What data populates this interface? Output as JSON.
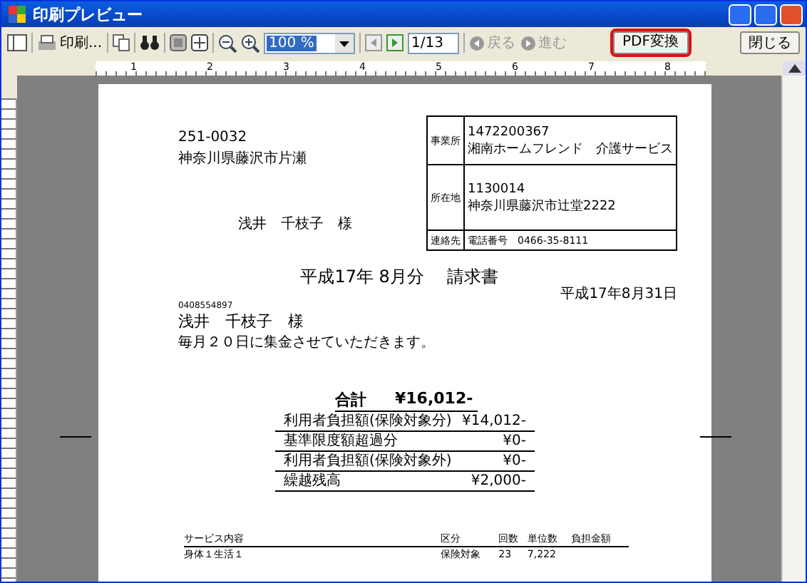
{
  "window": {
    "title": "印刷プレビュー"
  },
  "toolbar": {
    "print_label": "印刷...",
    "zoom": "100 %",
    "page": "1/13",
    "back": {
      "label": "戻る",
      "disabled": true
    },
    "forward": {
      "label": "進む",
      "disabled": true
    },
    "pdf_button": {
      "label": "PDF変換",
      "highlighted": true
    },
    "close_button": "閉じる"
  },
  "ruler": {
    "numbers": [
      "1",
      "2",
      "3",
      "4",
      "5",
      "6",
      "7",
      "8"
    ]
  },
  "document": {
    "sender": {
      "postcode": "251-0032",
      "address": "神奈川県藤沢市片瀬",
      "recipient": "浅井　千枝子　様"
    },
    "office_box": [
      {
        "label": "事業所",
        "lines": [
          "1472200367",
          "湘南ホームフレンド　介護サービス"
        ]
      },
      {
        "label": "所在地",
        "lines": [
          "1130014",
          "神奈川県藤沢市辻堂2222"
        ]
      },
      {
        "label": "連絡先",
        "lines": [
          "電話番号　0466-35-8111"
        ]
      }
    ],
    "title": "平成17年 8月分　 請求書",
    "date": "平成17年8月31日",
    "customer_code": "0408554897",
    "customer_name": "浅井　千枝子　様",
    "message": "毎月２０日に集金させていただきます。",
    "total": {
      "label": "合計",
      "amount": "¥16,012-"
    },
    "breakdown": [
      {
        "label": "利用者負担額(保険対象分)",
        "amount": "¥14,012-"
      },
      {
        "label": "基準限度額超過分",
        "amount": "¥0-"
      },
      {
        "label": "利用者負担額(保険対象外)",
        "amount": "¥0-"
      },
      {
        "label": "繰越残高",
        "amount": "¥2,000-"
      }
    ],
    "service_table": {
      "columns": [
        "サービス内容",
        "区分",
        "回数",
        "単位数",
        "負担金額"
      ],
      "rows": [
        [
          "身体１生活１",
          "保険対象",
          "23",
          "7,222",
          ""
        ]
      ]
    }
  }
}
